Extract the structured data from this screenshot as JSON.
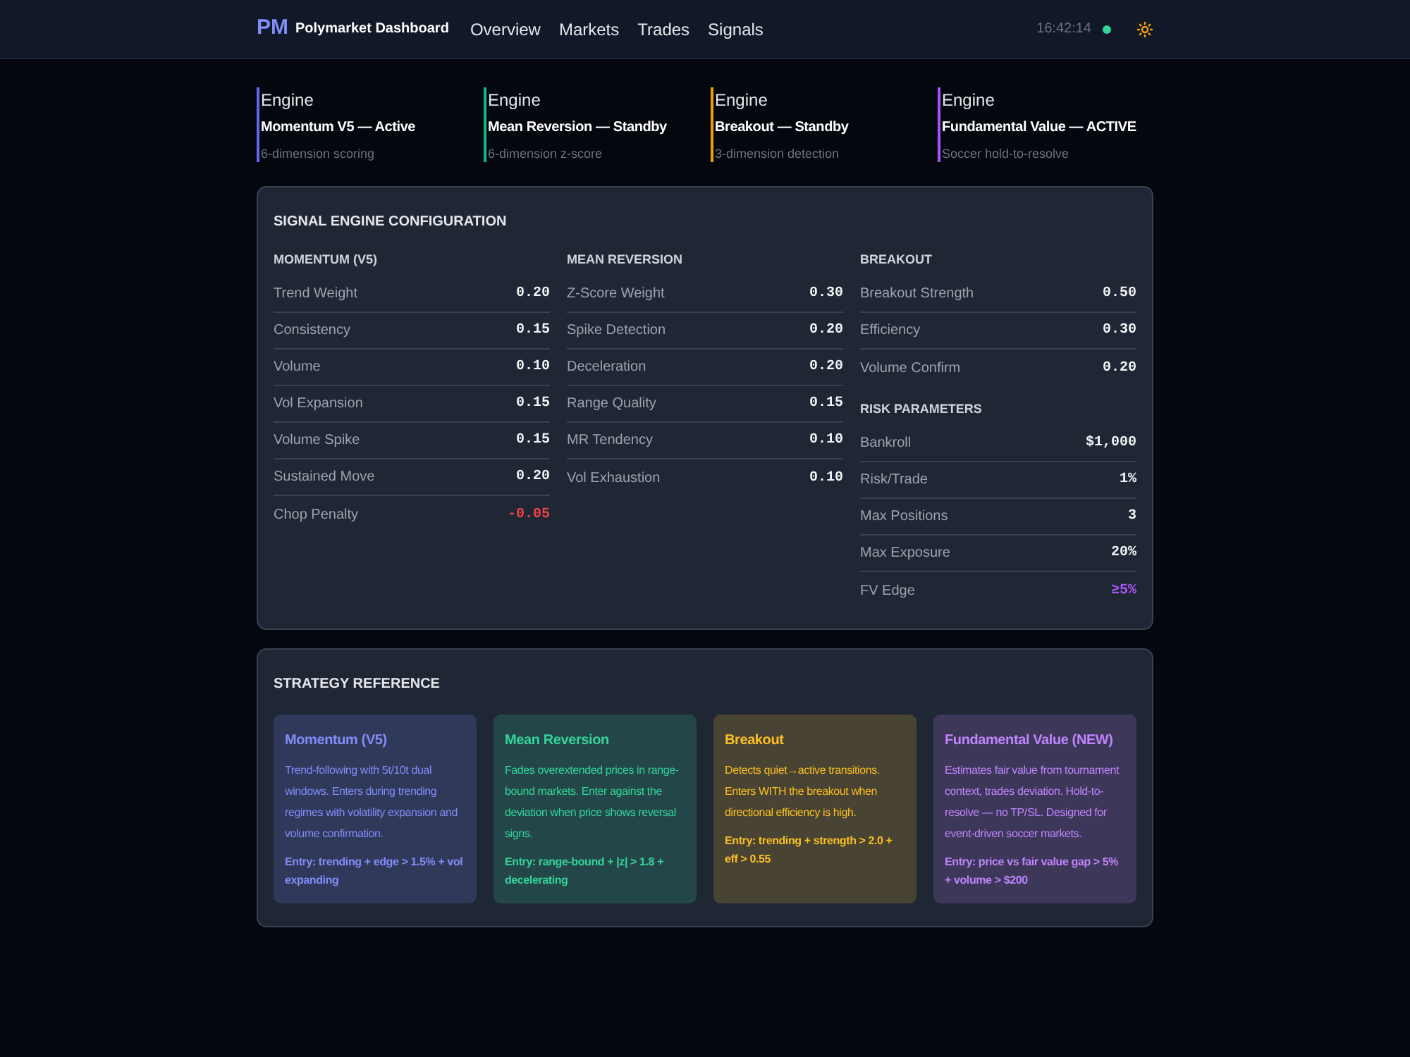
{
  "header": {
    "logo": "PM",
    "title": "Polymarket Dashboard",
    "nav": [
      "Overview",
      "Markets",
      "Trades",
      "Signals"
    ],
    "clock": "16:42:14"
  },
  "engines": [
    {
      "label": "Engine",
      "name": "Momentum V5 — Active",
      "detail": "6-dimension scoring",
      "color": "#6366f1"
    },
    {
      "label": "Engine",
      "name": "Mean Reversion — Standby",
      "detail": "6-dimension z-score",
      "color": "#10b981"
    },
    {
      "label": "Engine",
      "name": "Breakout — Standby",
      "detail": "3-dimension detection",
      "color": "#f59e0b"
    },
    {
      "label": "Engine",
      "name": "Fundamental Value — ACTIVE",
      "detail": "Soccer hold-to-resolve",
      "color": "#a855f7"
    }
  ],
  "config": {
    "title": "SIGNAL ENGINE CONFIGURATION",
    "columns": [
      [
        {
          "heading": "MOMENTUM (V5)",
          "rows": [
            {
              "label": "Trend Weight",
              "value": "0.20"
            },
            {
              "label": "Consistency",
              "value": "0.15"
            },
            {
              "label": "Volume",
              "value": "0.10"
            },
            {
              "label": "Vol Expansion",
              "value": "0.15"
            },
            {
              "label": "Volume Spike",
              "value": "0.15"
            },
            {
              "label": "Sustained Move",
              "value": "0.20"
            },
            {
              "label": "Chop Penalty",
              "value": "-0.05",
              "color": "#ef4444"
            }
          ]
        }
      ],
      [
        {
          "heading": "MEAN REVERSION",
          "rows": [
            {
              "label": "Z-Score Weight",
              "value": "0.30"
            },
            {
              "label": "Spike Detection",
              "value": "0.20"
            },
            {
              "label": "Deceleration",
              "value": "0.20"
            },
            {
              "label": "Range Quality",
              "value": "0.15"
            },
            {
              "label": "MR Tendency",
              "value": "0.10"
            },
            {
              "label": "Vol Exhaustion",
              "value": "0.10"
            }
          ]
        }
      ],
      [
        {
          "heading": "BREAKOUT",
          "rows": [
            {
              "label": "Breakout Strength",
              "value": "0.50"
            },
            {
              "label": "Efficiency",
              "value": "0.30"
            },
            {
              "label": "Volume Confirm",
              "value": "0.20"
            }
          ]
        },
        {
          "heading": "RISK PARAMETERS",
          "rows": [
            {
              "label": "Bankroll",
              "value": "$1,000"
            },
            {
              "label": "Risk/Trade",
              "value": "1%"
            },
            {
              "label": "Max Positions",
              "value": "3"
            },
            {
              "label": "Max Exposure",
              "value": "20%"
            },
            {
              "label": "FV Edge",
              "value": "≥5%",
              "color": "#a855f7"
            }
          ]
        }
      ]
    ]
  },
  "strategy_reference": {
    "title": "STRATEGY REFERENCE",
    "cards": [
      {
        "title": "Momentum (V5)",
        "description": "Trend-following with 5t/10t dual windows. Enters during trending regimes with volatility expansion and volume confirmation.",
        "entry": "Entry: trending + edge > 1.5% + vol expanding",
        "color": "#818cf8"
      },
      {
        "title": "Mean Reversion",
        "description": "Fades overextended prices in range-bound markets. Enter against the deviation when price shows reversal signs.",
        "entry": "Entry: range-bound + |z| > 1.8 + decelerating",
        "color": "#34d399"
      },
      {
        "title": "Breakout",
        "description": "Detects quiet→active transitions. Enters WITH the breakout when directional efficiency is high.",
        "entry": "Entry: trending + strength > 2.0 + eff > 0.55",
        "color": "#fbbf24"
      },
      {
        "title": "Fundamental Value (NEW)",
        "description": "Estimates fair value from tournament context, trades deviation. Hold-to-resolve — no TP/SL. Designed for event-driven soccer markets.",
        "entry": "Entry: price vs fair value gap > 5% + volume > $200",
        "color": "#c084fc"
      }
    ]
  }
}
